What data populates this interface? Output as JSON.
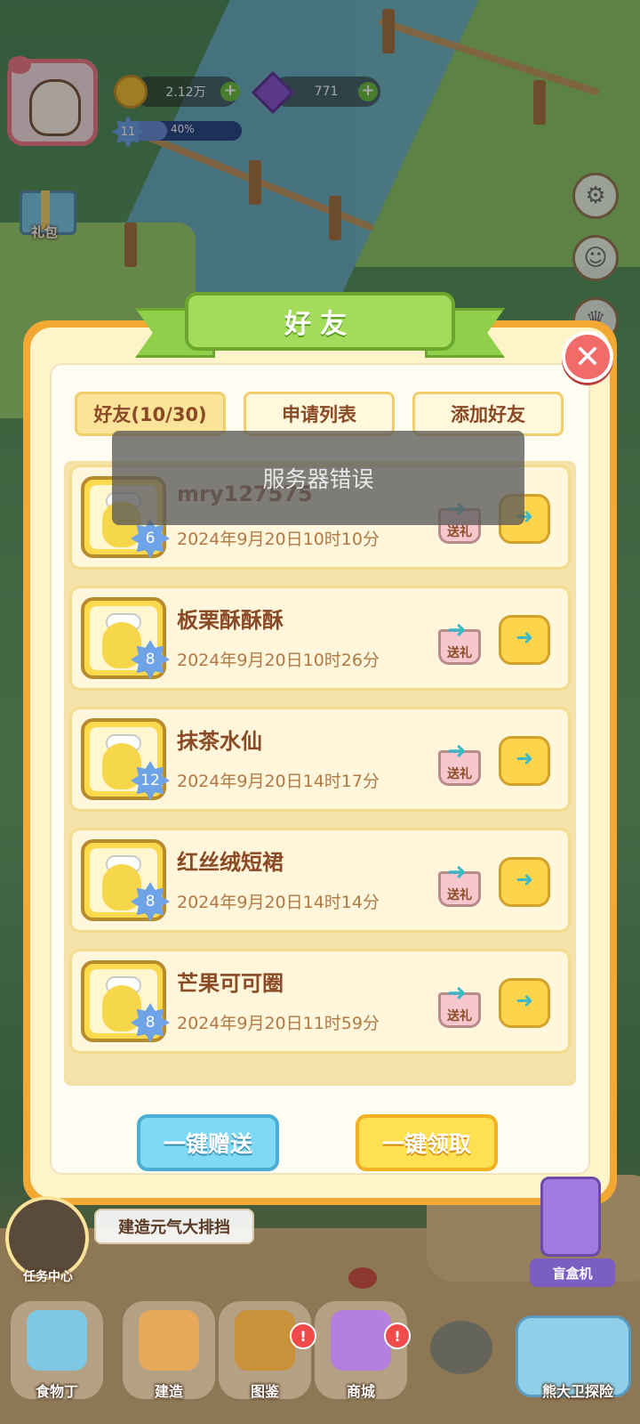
{
  "hud": {
    "coins": "2.12万",
    "gems": "771",
    "level": "11",
    "level_progress_text": "40%",
    "level_progress": 0.4,
    "gift_pack_label": "礼包"
  },
  "dialog": {
    "title": "好友",
    "close_icon": "close-icon",
    "tabs": [
      {
        "label": "好友(10/30)",
        "active": true
      },
      {
        "label": "申请列表",
        "active": false
      },
      {
        "label": "添加好友",
        "active": false
      }
    ],
    "toast": "服务器错误",
    "send_gift_label": "送礼",
    "friends": [
      {
        "name": "mry127575",
        "time": "2024年9月20日10时10分",
        "level": "6"
      },
      {
        "name": "板栗酥酥酥",
        "time": "2024年9月20日10时26分",
        "level": "8"
      },
      {
        "name": "抹茶水仙",
        "time": "2024年9月20日14时17分",
        "level": "12"
      },
      {
        "name": "红丝绒短裙",
        "time": "2024年9月20日14时14分",
        "level": "8"
      },
      {
        "name": "芒果可可圈",
        "time": "2024年9月20日11时59分",
        "level": "8"
      }
    ],
    "send_all_label": "一键赠送",
    "collect_all_label": "一键领取"
  },
  "bottom": {
    "task_center": "任务中心",
    "quest_text": "建造元气大排挡",
    "blind_box": "盲盒机",
    "dock": [
      {
        "label": "食物丁",
        "badge": ""
      },
      {
        "label": "建造",
        "badge": ""
      },
      {
        "label": "图鉴",
        "badge": "!"
      },
      {
        "label": "商城",
        "badge": "!"
      }
    ],
    "explore": "熊大卫探险"
  },
  "colors": {
    "panel_border": "#f3a834",
    "title_green": "#a3dc5a",
    "text_brown": "#8b4a26",
    "button_blue": "#7fd8f4",
    "button_yellow": "#ffe050",
    "close_red": "#f26b6b"
  }
}
